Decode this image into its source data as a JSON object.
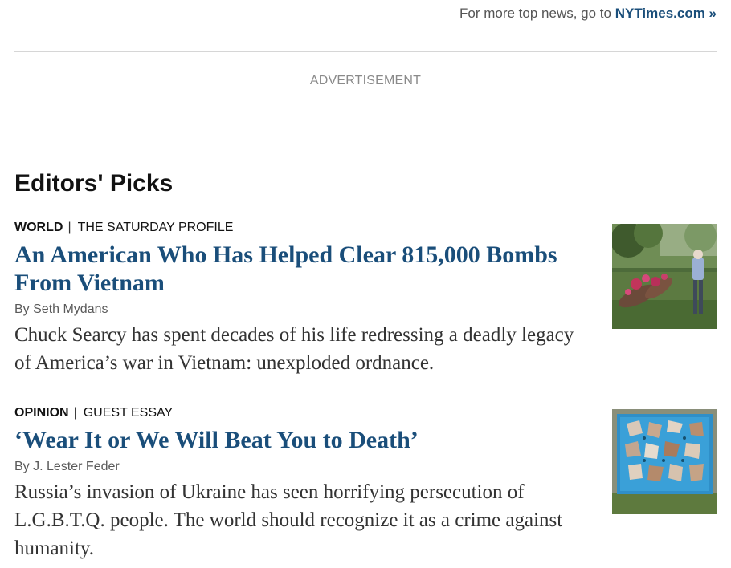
{
  "header": {
    "prefix": "For more top news, go to ",
    "link_label": "NYTimes.com »"
  },
  "ad": {
    "label": "ADVERTISEMENT"
  },
  "section": {
    "title": "Editors' Picks"
  },
  "stories": [
    {
      "section": "WORLD",
      "separator": "|",
      "subsection": "THE SATURDAY PROFILE",
      "headline": "An American Who Has Helped Clear 815,000 Bombs From Vietnam",
      "byline": "By Seth Mydans",
      "summary": "Chuck Searcy has spent decades of his life redressing a deadly legacy of America’s war in Vietnam: unexploded ordnance.",
      "thumbnail_icon": "photo-man-with-bombs"
    },
    {
      "section": "OPINION",
      "separator": "|",
      "subsection": "GUEST ESSAY",
      "headline": "‘Wear It or We Will Beat You to Death’",
      "byline": "By J. Lester Feder",
      "summary": "Russia’s invasion of Ukraine has seen horrifying persecution of L.G.B.T.Q. people. The world should recognize it as a crime against humanity.",
      "thumbnail_icon": "photo-blue-mosaic-wall"
    }
  ],
  "colors": {
    "headline": "#1a4e7a",
    "link": "#1a4e7a",
    "byline": "#5a5a5a",
    "summary": "#333333",
    "rule": "#d6d6d6"
  }
}
